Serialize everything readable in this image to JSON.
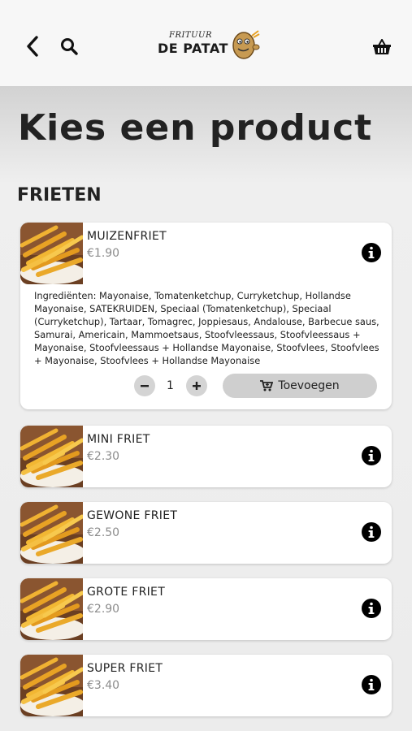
{
  "header": {
    "back_icon": "chevron-left-icon",
    "search_icon": "search-icon",
    "basket_icon": "basket-icon",
    "logo": {
      "top_text": "FRITUUR",
      "main_text": "DE PATAT"
    }
  },
  "page": {
    "title": "Kies een product",
    "section": "FRIETEN"
  },
  "products": [
    {
      "name": "MUIZENFRIET",
      "price": "€1.90",
      "ingredients": "Ingrediënten: Mayonaise, Tomatenketchup, Curryketchup, Hollandse Mayonaise, SATEKRUIDEN, Speciaal (Tomatenketchup), Speciaal (Curryketchup), Tartaar, Tomagrec, Joppiesaus, Andalouse, Barbecue saus, Samurai, Americain, Mammoetsaus, Stoofvleessaus, Stoofvleessaus + Mayonaise, Stoofvleessaus + Hollandse Mayonaise, Stoofvlees, Stoofvlees + Mayonaise, Stoofvlees + Hollandse Mayonaise",
      "quantity": "1",
      "add_label": "Toevoegen"
    },
    {
      "name": "MINI FRIET",
      "price": "€2.30"
    },
    {
      "name": "GEWONE FRIET",
      "price": "€2.50"
    },
    {
      "name": "GROTE FRIET",
      "price": "€2.90"
    },
    {
      "name": "SUPER FRIET",
      "price": "€3.40"
    }
  ],
  "colors": {
    "accent": "#000000",
    "price": "#8c8c8c",
    "button_bg": "#cfcfcf"
  }
}
